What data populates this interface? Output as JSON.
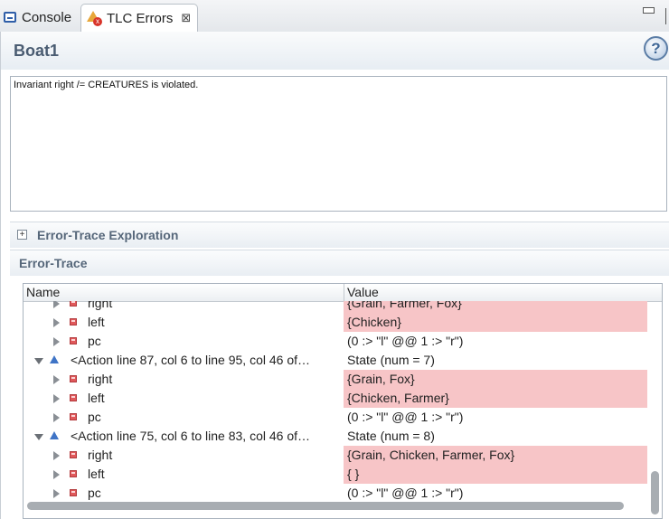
{
  "tabs": [
    {
      "label": "Console",
      "icon": "console-icon"
    },
    {
      "label": "TLC Errors",
      "icon": "tlc-error-icon",
      "active": true
    }
  ],
  "form": {
    "title": "Boat1",
    "error_message": "Invariant right /= CREATURES is violated."
  },
  "sections": {
    "exploration": "Error-Trace Exploration",
    "trace": "Error-Trace"
  },
  "table": {
    "columns": [
      "Name",
      "Value"
    ],
    "rows": [
      {
        "name": "right",
        "value": "{Grain, Farmer, Fox}",
        "kind": "var",
        "changed": true
      },
      {
        "name": "left",
        "value": "{Chicken}",
        "kind": "var",
        "changed": true
      },
      {
        "name": "pc",
        "value": "(0 :> \"l\" @@ 1 :> \"r\")",
        "kind": "var",
        "changed": false
      },
      {
        "name": "<Action line 87, col 6 to line 95, col 46 of…",
        "value": "State (num = 7)",
        "kind": "state",
        "changed": false
      },
      {
        "name": "right",
        "value": "{Grain, Fox}",
        "kind": "var",
        "changed": true
      },
      {
        "name": "left",
        "value": "{Chicken, Farmer}",
        "kind": "var",
        "changed": true
      },
      {
        "name": "pc",
        "value": "(0 :> \"l\" @@ 1 :> \"r\")",
        "kind": "var",
        "changed": false
      },
      {
        "name": "<Action line 75, col 6 to line 83, col 46 of…",
        "value": "State (num = 8)",
        "kind": "state",
        "changed": false
      },
      {
        "name": "right",
        "value": "{Grain, Chicken, Farmer, Fox}",
        "kind": "var",
        "changed": true
      },
      {
        "name": "left",
        "value": "{ }",
        "kind": "var",
        "changed": true
      },
      {
        "name": "pc",
        "value": "(0 :> \"l\" @@ 1 :> \"r\")",
        "kind": "var",
        "changed": false
      }
    ]
  },
  "colors": {
    "changed_highlight": "#f7c5c7",
    "section_title": "#56677a",
    "form_title": "#4a5c72"
  }
}
